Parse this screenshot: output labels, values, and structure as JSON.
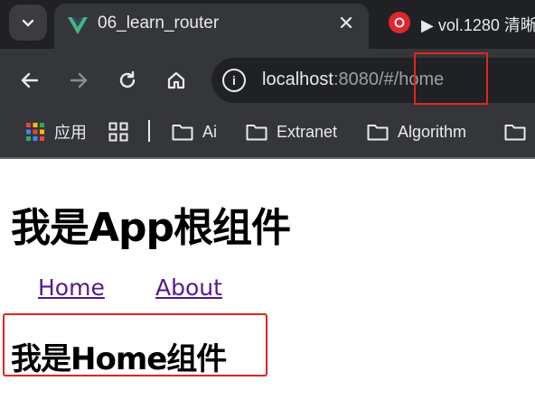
{
  "browser": {
    "tabs": [
      {
        "title": "06_learn_router",
        "favicon": "vue-logo-icon",
        "active": true
      },
      {
        "title": "▶ vol.1280 清晰",
        "favicon": "netease-music-icon",
        "active": false
      }
    ],
    "address_bar": {
      "host": "localhost",
      "rest": ":8080/#/home"
    },
    "bookmarks": [
      {
        "label": "应用",
        "icon": "apps-grid-icon"
      },
      {
        "label": "Ai",
        "icon": "folder-icon"
      },
      {
        "label": "Extranet",
        "icon": "folder-icon"
      },
      {
        "label": "Algorithm",
        "icon": "folder-icon"
      }
    ],
    "colors": {
      "chrome": "#35363a",
      "tabstrip": "#202124",
      "text": "#e8eaed",
      "accent_vue": "#42b883"
    }
  },
  "page": {
    "title": "我是App根组件",
    "links": [
      "Home",
      "About"
    ],
    "route_view_title": "我是Home组件",
    "colors": {
      "link": "#551a8b",
      "annotation": "#e0261d"
    }
  }
}
